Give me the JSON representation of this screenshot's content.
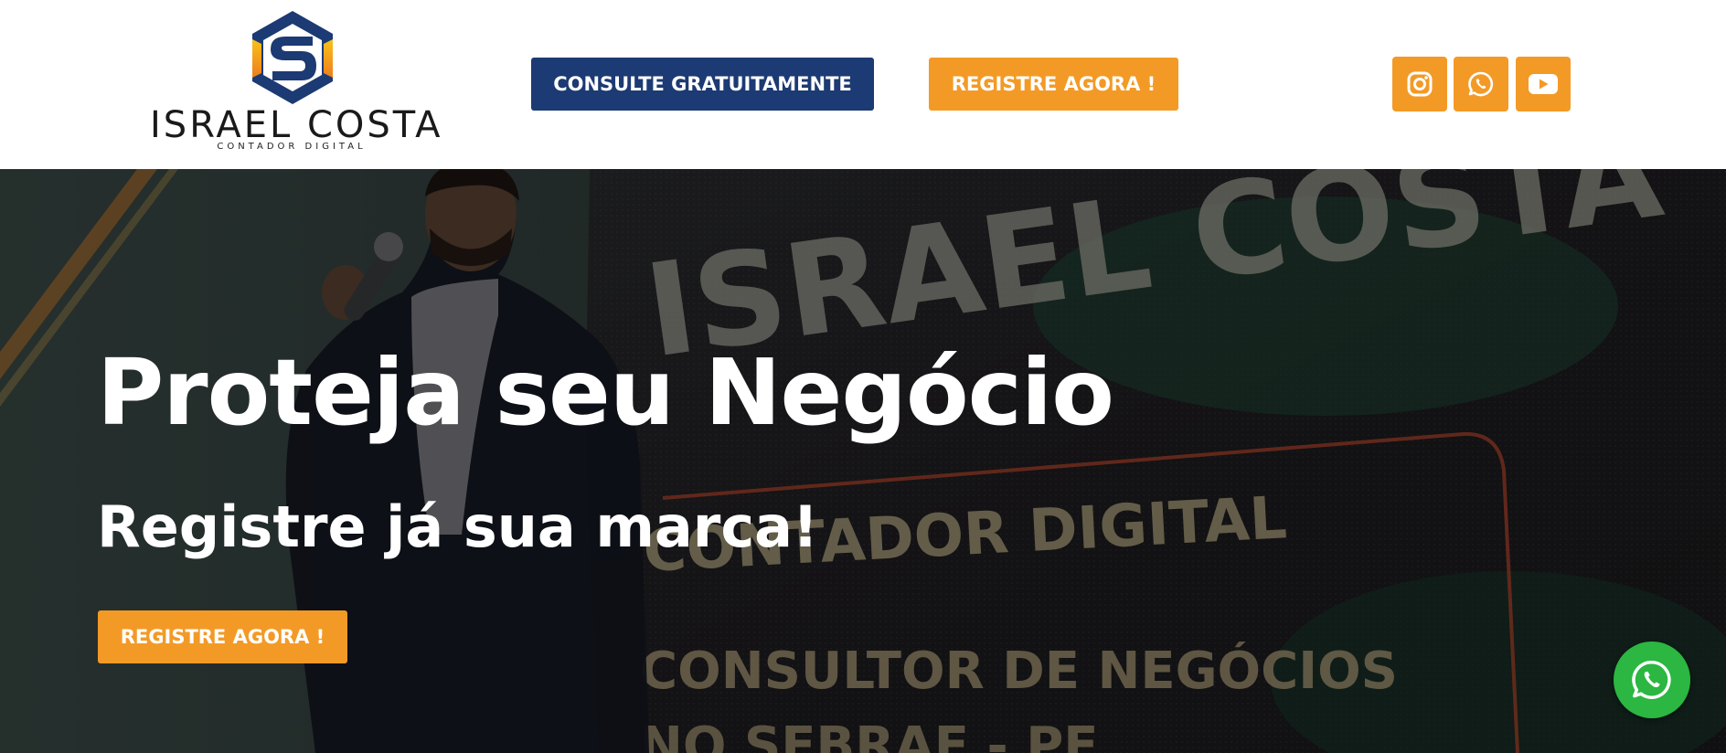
{
  "header": {
    "logo": {
      "name": "ISRAEL COSTA",
      "tagline": "CONTADOR DIGITAL",
      "icon": "hexagon-s-logo-icon"
    },
    "consult_button": "CONSULTE GRATUITAMENTE",
    "register_button": "REGISTRE AGORA !",
    "social": [
      {
        "name": "Instagram",
        "icon": "instagram-icon"
      },
      {
        "name": "WhatsApp",
        "icon": "whatsapp-icon"
      },
      {
        "name": "YouTube",
        "icon": "youtube-icon"
      }
    ]
  },
  "hero": {
    "title": "Proteja seu Negócio",
    "subtitle": "Registre já sua marca!",
    "register_button": "REGISTRE AGORA !",
    "background": {
      "screen_text_1": "ISRAEL COSTA",
      "screen_text_2": "CONTADOR DIGITAL",
      "screen_text_3": "CONSULTOR DE NEGÓCIOS",
      "screen_text_4": "NO SEBRAE - PE"
    }
  },
  "floating_whatsapp": {
    "icon": "whatsapp-icon"
  },
  "colors": {
    "brand_navy": "#1c3a73",
    "brand_orange": "#f39a26",
    "whatsapp_green": "#2bb741",
    "text_white": "#ffffff"
  }
}
